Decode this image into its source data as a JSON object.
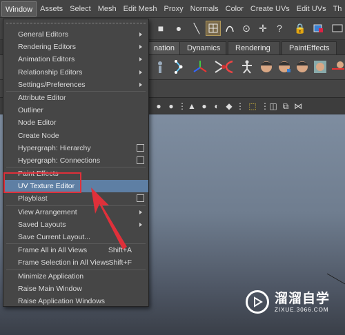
{
  "menubar": {
    "items": [
      "Window",
      "Assets",
      "Select",
      "Mesh",
      "Edit Mesh",
      "Proxy",
      "Normals",
      "Color",
      "Create UVs",
      "Edit UVs",
      "Th"
    ],
    "active_index": 0
  },
  "shelf_tabs": {
    "items": [
      "nation",
      "Dynamics",
      "Rendering",
      "PaintEffects"
    ]
  },
  "window_menu": {
    "sections": [
      [
        {
          "label": "General Editors",
          "submenu": true
        },
        {
          "label": "Rendering Editors",
          "submenu": true
        },
        {
          "label": "Animation Editors",
          "submenu": true
        },
        {
          "label": "Relationship Editors",
          "submenu": true
        },
        {
          "label": "Settings/Preferences",
          "submenu": true
        }
      ],
      [
        {
          "label": "Attribute Editor"
        },
        {
          "label": "Outliner"
        },
        {
          "label": "Node Editor"
        },
        {
          "label": "Create Node"
        },
        {
          "label": "Hypergraph: Hierarchy",
          "option_box": true
        },
        {
          "label": "Hypergraph: Connections",
          "option_box": true
        }
      ],
      [
        {
          "label": "Paint Effects"
        },
        {
          "label": "UV Texture Editor",
          "highlighted": true
        },
        {
          "label": "Playblast",
          "option_box": true
        }
      ],
      [
        {
          "label": "View Arrangement",
          "submenu": true
        },
        {
          "label": "Saved Layouts",
          "submenu": true
        },
        {
          "label": "Save Current Layout..."
        }
      ],
      [
        {
          "label": "Frame All in All Views",
          "shortcut": "Shift+A"
        },
        {
          "label": "Frame Selection in All Views",
          "shortcut": "Shift+F"
        }
      ],
      [
        {
          "label": "Minimize Application"
        },
        {
          "label": "Raise Main Window"
        },
        {
          "label": "Raise Application Windows"
        }
      ]
    ]
  },
  "annotation": {
    "color": "#e0303a"
  },
  "watermark": {
    "title": "溜溜自学",
    "subtitle": "ZIXUE.3066.COM"
  },
  "colors": {
    "highlight": "#5e7fa4",
    "menu_bg": "#464646",
    "viewport_top": "#7e8da0"
  }
}
